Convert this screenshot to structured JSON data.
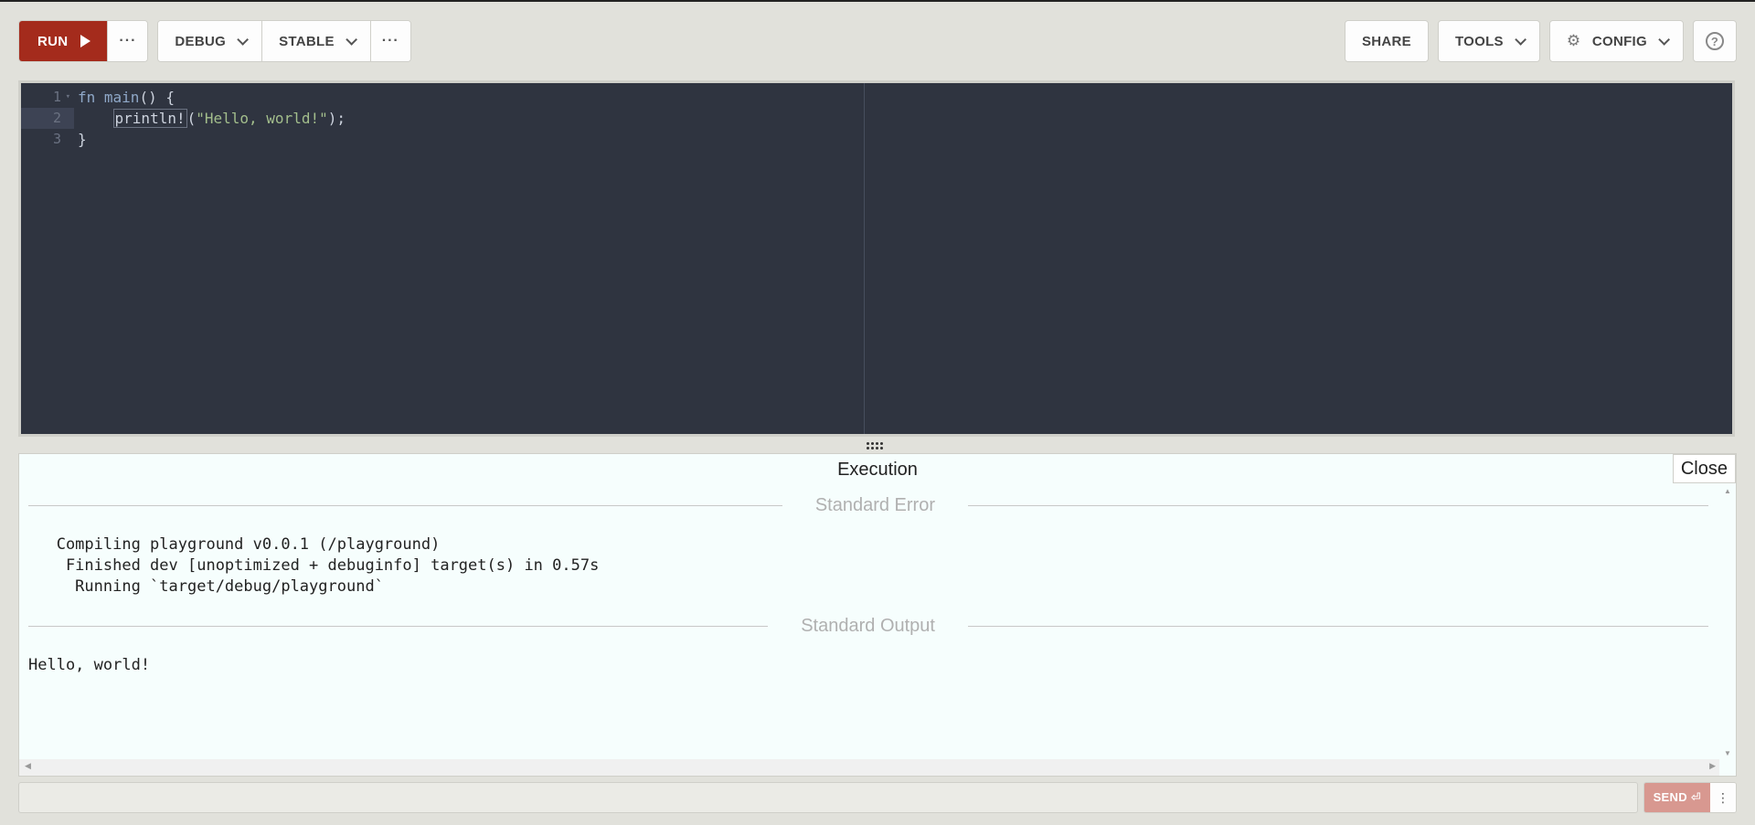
{
  "toolbar": {
    "run_label": "RUN",
    "more_label": "···",
    "debug_label": "DEBUG",
    "channel_label": "STABLE",
    "more2_label": "···",
    "share_label": "SHARE",
    "tools_label": "TOOLS",
    "config_label": "CONFIG",
    "help_label": "?"
  },
  "editor": {
    "lines": [
      "1",
      "2",
      "3"
    ],
    "code": {
      "l1_kw": "fn",
      "l1_name": " main",
      "l1_rest": "() {",
      "l2_indent": "    ",
      "l2_macro": "println!",
      "l2_open": "(",
      "l2_str": "\"Hello, world!\"",
      "l2_close": ");",
      "l3": "}"
    }
  },
  "output": {
    "title": "Execution",
    "close_label": "Close",
    "stderr_label": "Standard Error",
    "stderr_text": "   Compiling playground v0.0.1 (/playground)\n    Finished dev [unoptimized + debuginfo] target(s) in 0.57s\n     Running `target/debug/playground`",
    "stdout_label": "Standard Output",
    "stdout_text": "Hello, world!"
  },
  "stdin": {
    "value": "",
    "send_label": "SEND ⏎",
    "more_label": "⋮"
  },
  "colors": {
    "accent": "#a42b1c",
    "editor_bg": "#2f3440",
    "output_bg": "#f6fefd"
  },
  "icons": [
    "play-icon",
    "chevron-down-icon",
    "gear-icon",
    "help-icon",
    "ellipsis-icon",
    "kebab-icon"
  ]
}
